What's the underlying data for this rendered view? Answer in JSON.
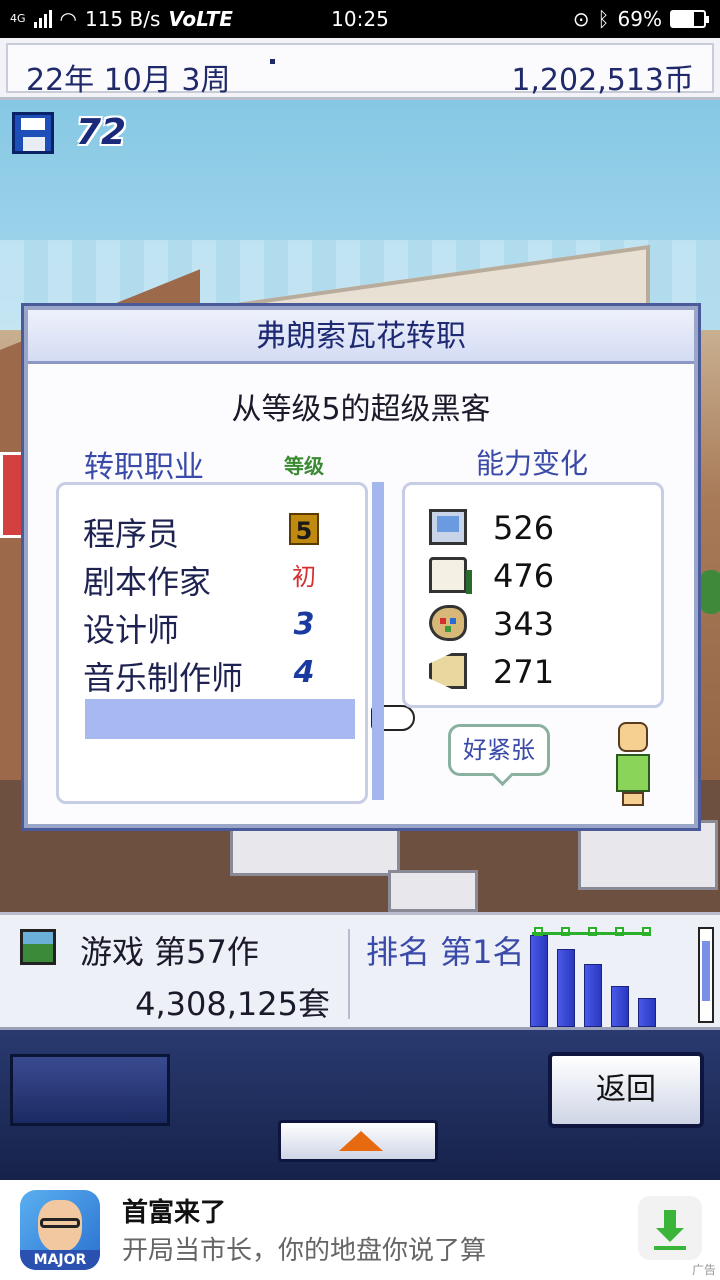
{
  "status_bar": {
    "network": "4G",
    "speed": "115 B/s",
    "volte": "VoLTE",
    "time": "10:25",
    "battery": "69%",
    "battery_level": 0.69
  },
  "top_bar": {
    "date": "22年 10月 3周",
    "money": "1,202,513币"
  },
  "save_count": "72",
  "dialog": {
    "title": "弗朗索瓦花转职",
    "subtitle": "从等级5的超级黑客",
    "job_label": "转职职业",
    "level_label": "等级",
    "ability_label": "能力变化",
    "jobs": [
      {
        "name": "程序员",
        "level": "5"
      },
      {
        "name": "剧本作家",
        "level": "初"
      },
      {
        "name": "设计师",
        "level": "3"
      },
      {
        "name": "音乐制作师",
        "level": "4"
      }
    ],
    "abilities": [
      {
        "icon": "computer-icon",
        "value": "526"
      },
      {
        "icon": "book-icon",
        "value": "476"
      },
      {
        "icon": "palette-icon",
        "value": "343"
      },
      {
        "icon": "trumpet-icon",
        "value": "271"
      }
    ],
    "speech": "好紧张"
  },
  "info_bar": {
    "game_title": "游戏 第57作",
    "sales": "4,308,125套",
    "rank": "排名 第1名"
  },
  "chart_data": {
    "type": "bar",
    "values": [
      10,
      8.5,
      6.8,
      4.5,
      3.2
    ]
  },
  "controls": {
    "back_label": "返回"
  },
  "ad": {
    "icon_badge": "MAJOR",
    "title": "首富来了",
    "description": "开局当市长，你的地盘你说了算",
    "tag": "广告"
  }
}
